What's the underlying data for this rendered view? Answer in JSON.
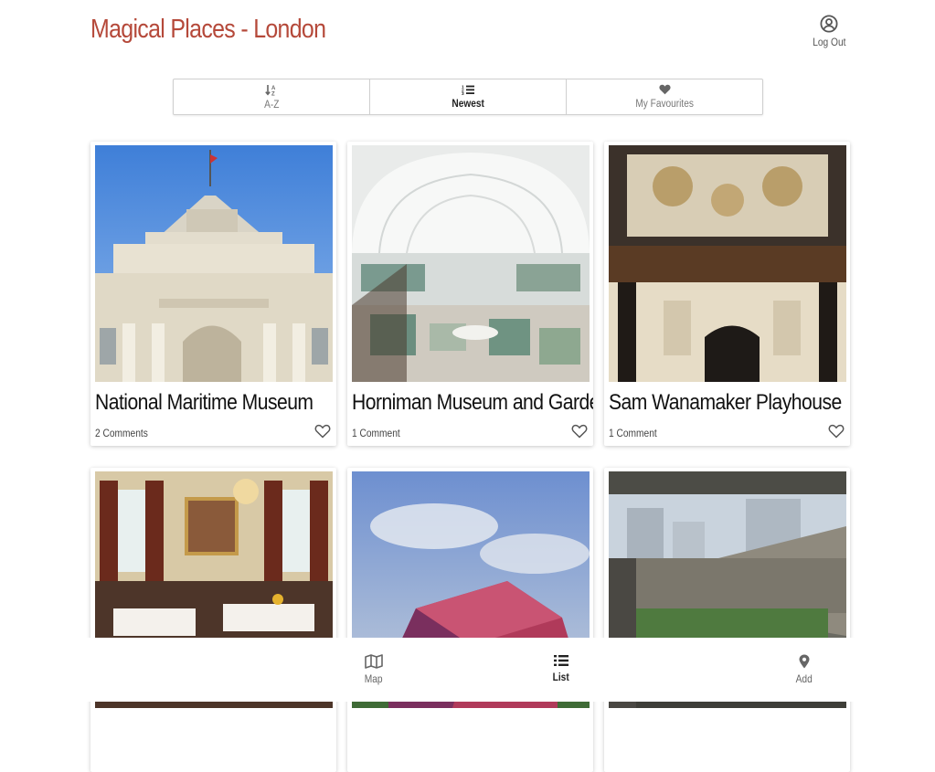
{
  "header": {
    "title": "Magical Places - London",
    "logout_label": "Log Out",
    "title_color": "#b5493a"
  },
  "sort": {
    "options": [
      {
        "label": "A-Z",
        "icon": "sort-alpha-icon",
        "active": false
      },
      {
        "label": "Newest",
        "icon": "list-numbered-icon",
        "active": true
      },
      {
        "label": "My Favourites",
        "icon": "heart-icon",
        "active": false
      }
    ]
  },
  "places": [
    {
      "name": "National Maritime Museum",
      "comments": "2 Comments",
      "image": "photo of museum facade with clock and flag"
    },
    {
      "name": "Horniman Museum and Gardens",
      "comments": "1 Comment",
      "image": "photo of arched museum gallery"
    },
    {
      "name": "Sam Wanamaker Playhouse",
      "comments": "1 Comment",
      "image": "photo of wooden theatre interior"
    },
    {
      "name": "",
      "comments": "",
      "image": "photo of restaurant dining room"
    },
    {
      "name": "",
      "comments": "",
      "image": "photo of colourful barrel sculpture"
    },
    {
      "name": "",
      "comments": "",
      "image": "photo of concrete estate and lake"
    }
  ],
  "bottom_nav": {
    "items": [
      {
        "label": "Map",
        "icon": "map-icon",
        "active": false
      },
      {
        "label": "List",
        "icon": "list-icon",
        "active": true
      },
      {
        "label": "Add",
        "icon": "map-pin-icon",
        "active": false
      }
    ]
  }
}
